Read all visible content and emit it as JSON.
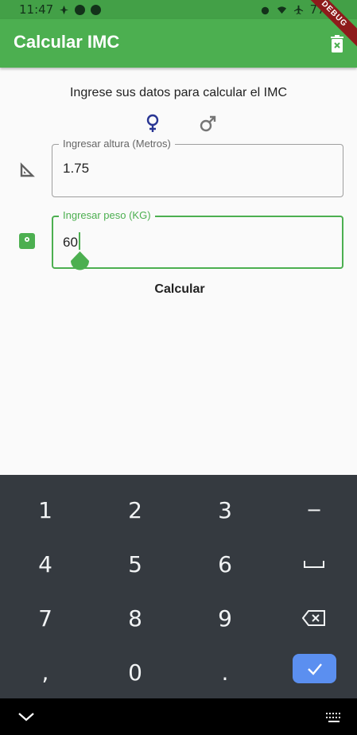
{
  "status_bar": {
    "time": "11:47",
    "battery": "77%",
    "left_icons": [
      "notification-icon",
      "spotify-icon",
      "messenger-icon"
    ],
    "right_icons": [
      "alarm-icon",
      "wifi-icon",
      "airplane-icon",
      "battery-icon"
    ]
  },
  "debug_banner": "DEBUG",
  "app_bar": {
    "title": "Calcular IMC",
    "action_icon": "delete-icon",
    "color": "#4caf50"
  },
  "main": {
    "subtitle": "Ingrese sus datos para calcular el IMC",
    "gender": {
      "female_icon": "female-icon",
      "male_icon": "male-icon",
      "selected": "female"
    },
    "height_field": {
      "label": "Ingresar altura (Metros)",
      "value": "1.75",
      "icon": "ruler-icon"
    },
    "weight_field": {
      "label": "Ingresar peso (KG)",
      "value": "60",
      "icon": "scale-icon",
      "focused": true
    },
    "calculate_button": "Calcular"
  },
  "keyboard": {
    "rows": [
      [
        "1",
        "2",
        "3",
        "−"
      ],
      [
        "4",
        "5",
        "6",
        "␣"
      ],
      [
        "7",
        "8",
        "9",
        "⌫"
      ],
      [
        ",",
        "0",
        ".",
        "✓"
      ]
    ],
    "accent": "#5b8ff0"
  },
  "nav_bar": {
    "left_icon": "chevron-down-icon",
    "right_icon": "keyboard-icon"
  }
}
